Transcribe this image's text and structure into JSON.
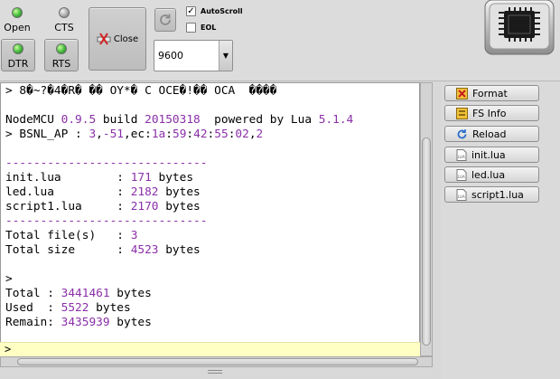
{
  "signals": {
    "open": {
      "label": "Open",
      "state": "green"
    },
    "cts": {
      "label": "CTS",
      "state": "gray"
    },
    "dtr": {
      "label": "DTR",
      "state": "green"
    },
    "rts": {
      "label": "RTS",
      "state": "green"
    }
  },
  "toolbar": {
    "close_label": "Close",
    "autoscroll": {
      "label": "AutoScroll",
      "checked": true
    },
    "eol": {
      "label": "EOL",
      "checked": false
    },
    "baud_rate": "9600"
  },
  "terminal": {
    "lines": [
      [
        {
          "t": "> 8�~?�4�R� �� OY*� C OCE�!�� OCA  ����"
        }
      ],
      [
        {
          "t": ""
        }
      ],
      [
        {
          "t": "NodeMCU "
        },
        {
          "t": "0.9.5",
          "n": true
        },
        {
          "t": " build "
        },
        {
          "t": "20150318",
          "n": true
        },
        {
          "t": "  powered by Lua "
        },
        {
          "t": "5.1.4",
          "n": true
        }
      ],
      [
        {
          "t": "> BSNL_AP : "
        },
        {
          "t": "3",
          "n": true
        },
        {
          "t": ","
        },
        {
          "t": "-51",
          "n": true
        },
        {
          "t": ",ec:"
        },
        {
          "t": "1a",
          "n": true
        },
        {
          "t": ":"
        },
        {
          "t": "59",
          "n": true
        },
        {
          "t": ":"
        },
        {
          "t": "42",
          "n": true
        },
        {
          "t": ":"
        },
        {
          "t": "55",
          "n": true
        },
        {
          "t": ":"
        },
        {
          "t": "02",
          "n": true
        },
        {
          "t": ","
        },
        {
          "t": "2",
          "n": true
        }
      ],
      [
        {
          "t": ""
        }
      ],
      [
        {
          "t": "-----------------------------",
          "n": true
        }
      ],
      [
        {
          "t": "init.lua        : "
        },
        {
          "t": "171",
          "n": true
        },
        {
          "t": " bytes"
        }
      ],
      [
        {
          "t": "led.lua         : "
        },
        {
          "t": "2182",
          "n": true
        },
        {
          "t": " bytes"
        }
      ],
      [
        {
          "t": "script1.lua     : "
        },
        {
          "t": "2170",
          "n": true
        },
        {
          "t": " bytes"
        }
      ],
      [
        {
          "t": "-----------------------------",
          "n": true
        }
      ],
      [
        {
          "t": "Total file(s)   : "
        },
        {
          "t": "3",
          "n": true
        }
      ],
      [
        {
          "t": "Total size      : "
        },
        {
          "t": "4523",
          "n": true
        },
        {
          "t": " bytes"
        }
      ],
      [
        {
          "t": ""
        }
      ],
      [
        {
          "t": ">"
        }
      ],
      [
        {
          "t": "Total : "
        },
        {
          "t": "3441461",
          "n": true
        },
        {
          "t": " bytes"
        }
      ],
      [
        {
          "t": "Used  : "
        },
        {
          "t": "5522",
          "n": true
        },
        {
          "t": " bytes"
        }
      ],
      [
        {
          "t": "Remain: "
        },
        {
          "t": "3435939",
          "n": true
        },
        {
          "t": " bytes"
        }
      ]
    ],
    "input_prompt": ">"
  },
  "side_buttons": [
    {
      "label": "Format",
      "icon": "format-icon"
    },
    {
      "label": "FS Info",
      "icon": "fs-info-icon"
    },
    {
      "label": "Reload",
      "icon": "reload-icon"
    },
    {
      "label": "init.lua",
      "icon": "lua-file-icon"
    },
    {
      "label": "led.lua",
      "icon": "lua-file-icon"
    },
    {
      "label": "script1.lua",
      "icon": "lua-file-icon"
    }
  ],
  "colors": {
    "number": "#8a2fa8",
    "input_bg": "#ffffc4"
  }
}
